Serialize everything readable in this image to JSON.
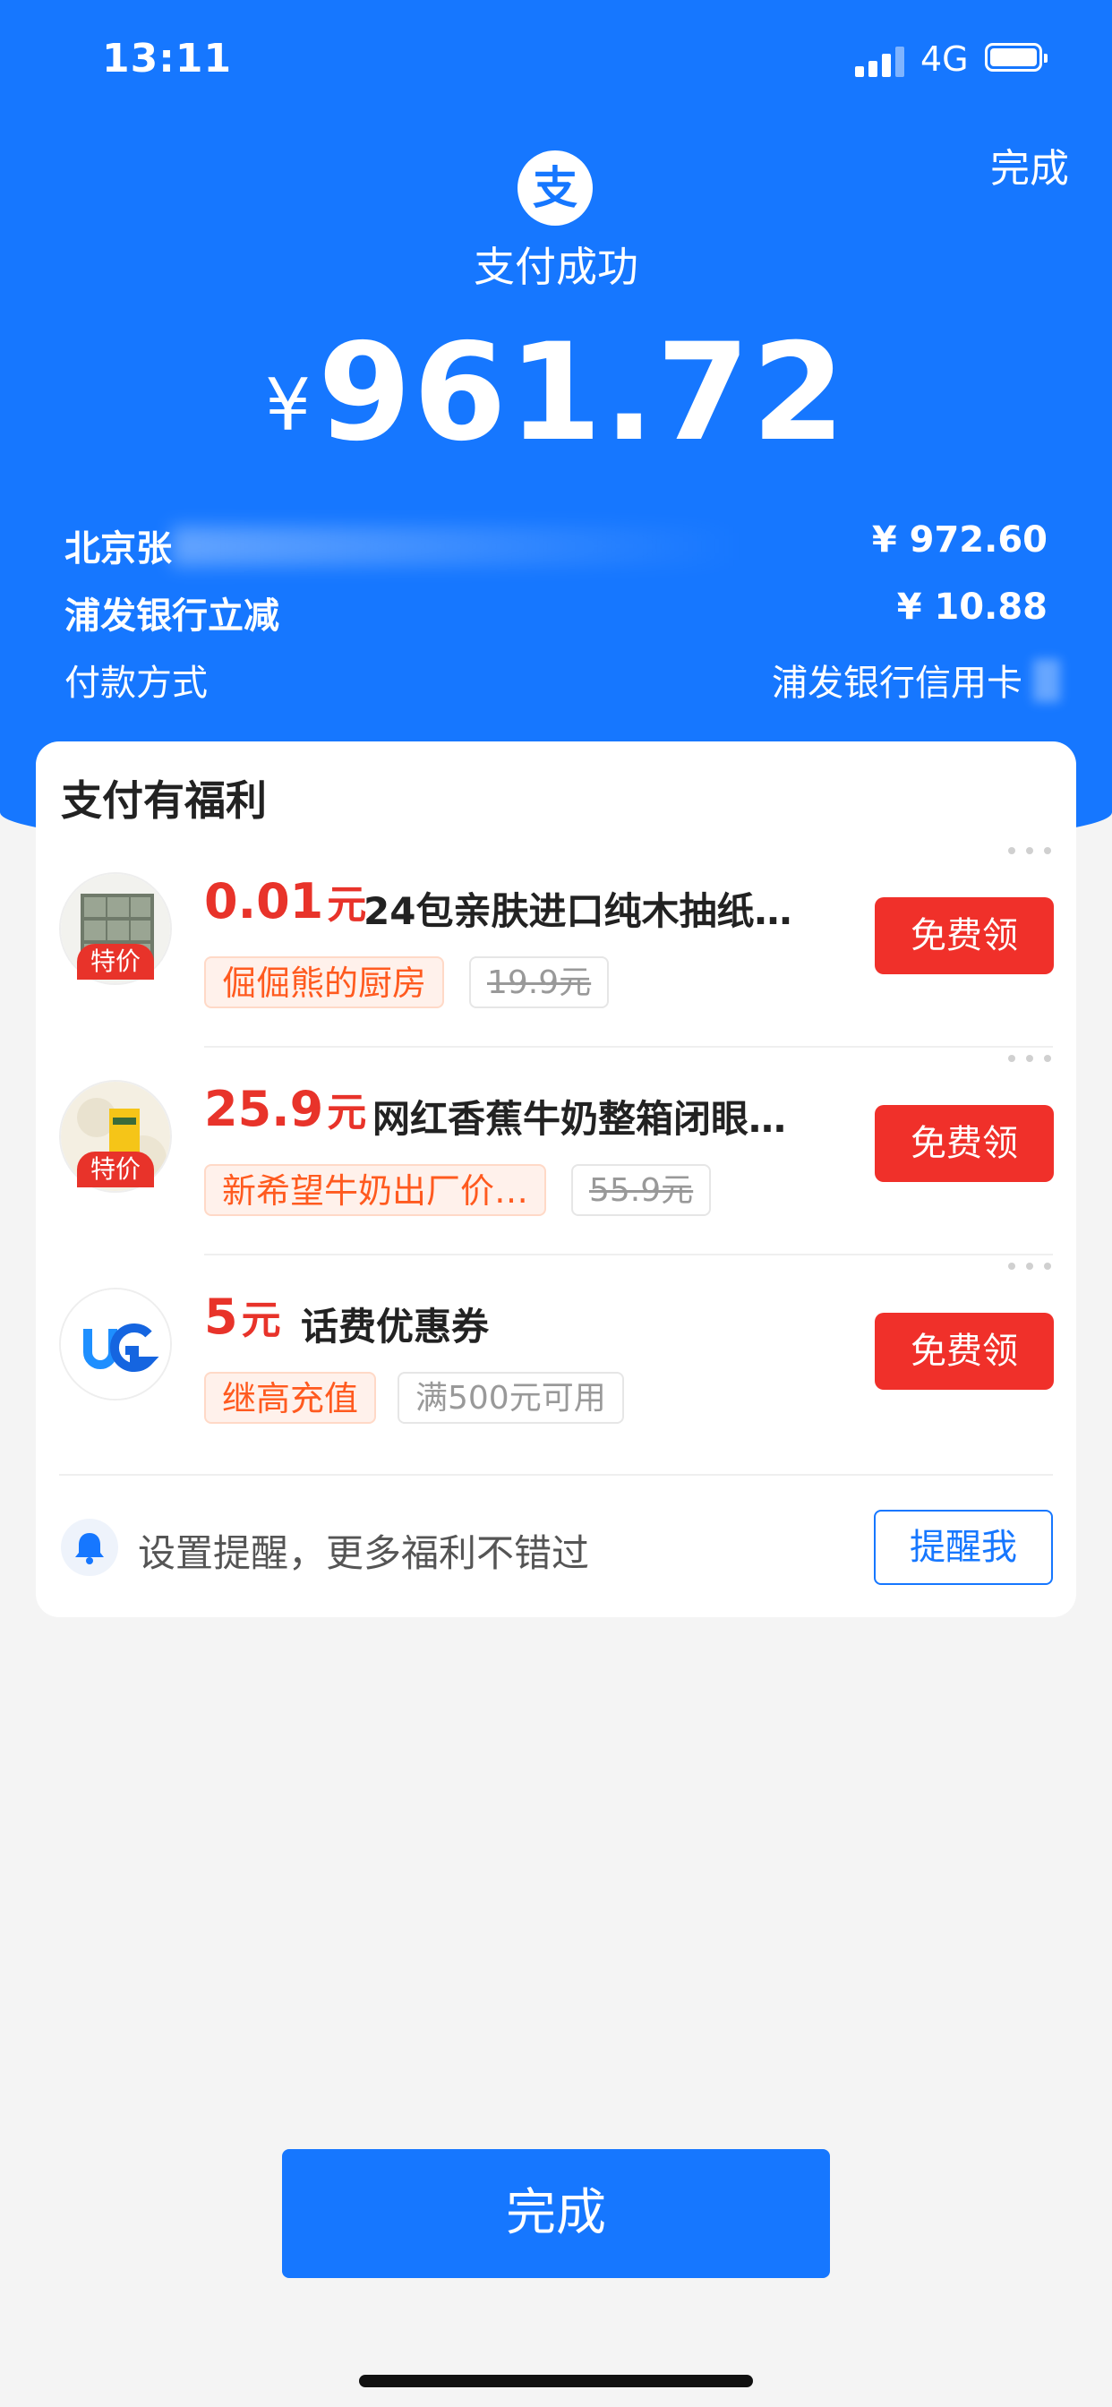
{
  "status_bar": {
    "time": "13:11",
    "network": "4G"
  },
  "header": {
    "done_label": "完成",
    "logo_glyph": "支",
    "title": "支付成功",
    "currency": "¥",
    "amount": "961.72"
  },
  "details": [
    {
      "label": "北京张",
      "value": "¥ 972.60"
    },
    {
      "label": "浦发银行立减",
      "value": "¥ 10.88"
    },
    {
      "label": "付款方式",
      "value": "浦发银行信用卡"
    }
  ],
  "benefits": {
    "title": "支付有福利",
    "items": [
      {
        "price": "0.01",
        "unit": "元",
        "name": "24包亲肤进口纯木抽纸…",
        "shop": "倔倔熊的厨房",
        "original": "19.9元",
        "badge": "特价",
        "claim": "免费领"
      },
      {
        "price": "25.9",
        "unit": "元",
        "name": "网红香蕉牛奶整箱闭眼…",
        "shop": "新希望牛奶出厂价…",
        "original": "55.9元",
        "badge": "特价",
        "claim": "免费领"
      },
      {
        "price": "5",
        "unit": "元",
        "name": "话费优惠券",
        "shop": "继高充值",
        "original": "满500元可用",
        "claim": "免费领"
      }
    ],
    "reminder": {
      "text": "设置提醒，更多福利不错过",
      "button": "提醒我"
    }
  },
  "footer": {
    "done_button": "完成"
  },
  "colors": {
    "brand_blue": "#1677ff",
    "accent_red": "#e8332a",
    "claim_red": "#f0302a"
  }
}
